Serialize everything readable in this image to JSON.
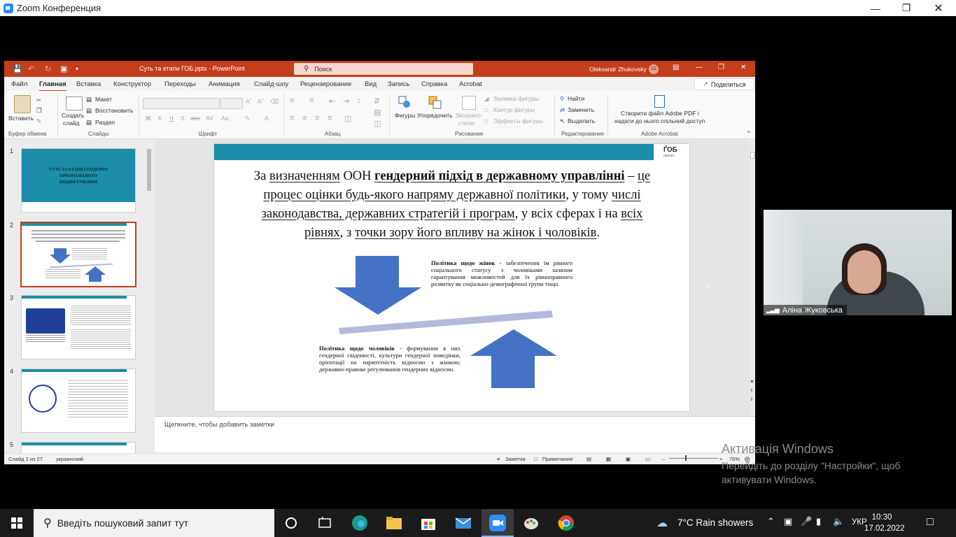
{
  "zoom": {
    "title": "Zoom Конференция"
  },
  "ppt": {
    "docname": "Суть та етапи ГОБ.pptx  -  PowerPoint",
    "search_placeholder": "Поиск",
    "user": "Oleksandr Zhukovsky",
    "user_initials": "OZ",
    "tabs": [
      "Файл",
      "Главная",
      "Вставка",
      "Конструктор",
      "Переходы",
      "Анимация",
      "Слайд-шоу",
      "Рецензирование",
      "Вид",
      "Запись",
      "Справка",
      "Acrobat"
    ],
    "share": "Поделиться",
    "ribbon": {
      "paste": "Вставить",
      "new_slide_1": "Создать",
      "new_slide_2": "слайд",
      "layout": "Макет",
      "reset": "Восстановить",
      "section": "Раздел",
      "shapes": "Фигуры",
      "arrange": "Упорядочить",
      "quick_styles_1": "Экспресс-",
      "quick_styles_2": "стили",
      "fill": "Заливка фигуры",
      "outline": "Контур фигуры",
      "effects": "Эффекты фигуры",
      "find": "Найти",
      "replace": "Заменить",
      "select": "Выделить",
      "acrobat_1": "Створити файл Adobe PDF і",
      "acrobat_2": "надати до нього спільний доступ",
      "groups": [
        "Буфер обмена",
        "Слайды",
        "Шрифт",
        "Абзац",
        "Рисование",
        "Редактирование",
        "Adobe Acrobat"
      ]
    },
    "thumb_numbers": [
      "1",
      "2",
      "3",
      "4",
      "5"
    ],
    "thumb1_title": "СУТЬ ТА ЕТАПИ ГЕНДЕРНО ОРІЄНТОВАНОГО БЮДЖЕТУВАННЯ",
    "slide": {
      "logo": "ҐОБ",
      "logo_sub": "проєкт",
      "t1": "За ",
      "t2": "визначенням",
      "t3": " ООН ",
      "t4": "гендерний підхід в державному управлінні",
      "t5": " – ",
      "t6": "це процес оцінки будь-якого напряму державної політики",
      "t7": ", у тому ",
      "t8": "числі законодавства, державних стратегій і програм",
      "t9": ", у всіх сферах і на ",
      "t10": "всіх рівнях",
      "t11": ", з ",
      "t12": "точки зору його впливу на жінок і чоловіків",
      "t13": ".",
      "women_bold": "Політика щодо жінок",
      "women_text": " - забезпечення їм рівного соціального статусу з чоловіками шляхом гарантування можливостей для їх рівноправного розвитку як соціально-демографічної групи тощо.",
      "men_bold": "Політика щодо чоловіків",
      "men_text": " - формування в них гендерної свідомості, культури гендерної поведінки, орієнтації на паритетність відносин з жінкою; державно-правове регулювання гендерних відносин."
    },
    "notes_placeholder": "Щелкните, чтобы добавить заметки",
    "status": {
      "slide": "Слайд 2 из 27",
      "lang": "украинский",
      "notes": "Заметки",
      "comments": "Примечания",
      "zoom": "76%"
    }
  },
  "video": {
    "name": "Аліна Жуковська"
  },
  "activation": {
    "title": "Активація Windows",
    "line1": "Перейдіть до розділу \"Настройки\", щоб",
    "line2": "активувати Windows."
  },
  "taskbar": {
    "search": "Введіть пошуковий запит тут",
    "weather": "7°C  Rain showers",
    "lang": "УКР",
    "time": "10:30",
    "date": "17.02.2022"
  },
  "colors": {
    "ppt_accent": "#c43e1c",
    "slide_bar": "#1b8da8",
    "arrow": "#4472c4",
    "line": "#b4b9dc"
  }
}
